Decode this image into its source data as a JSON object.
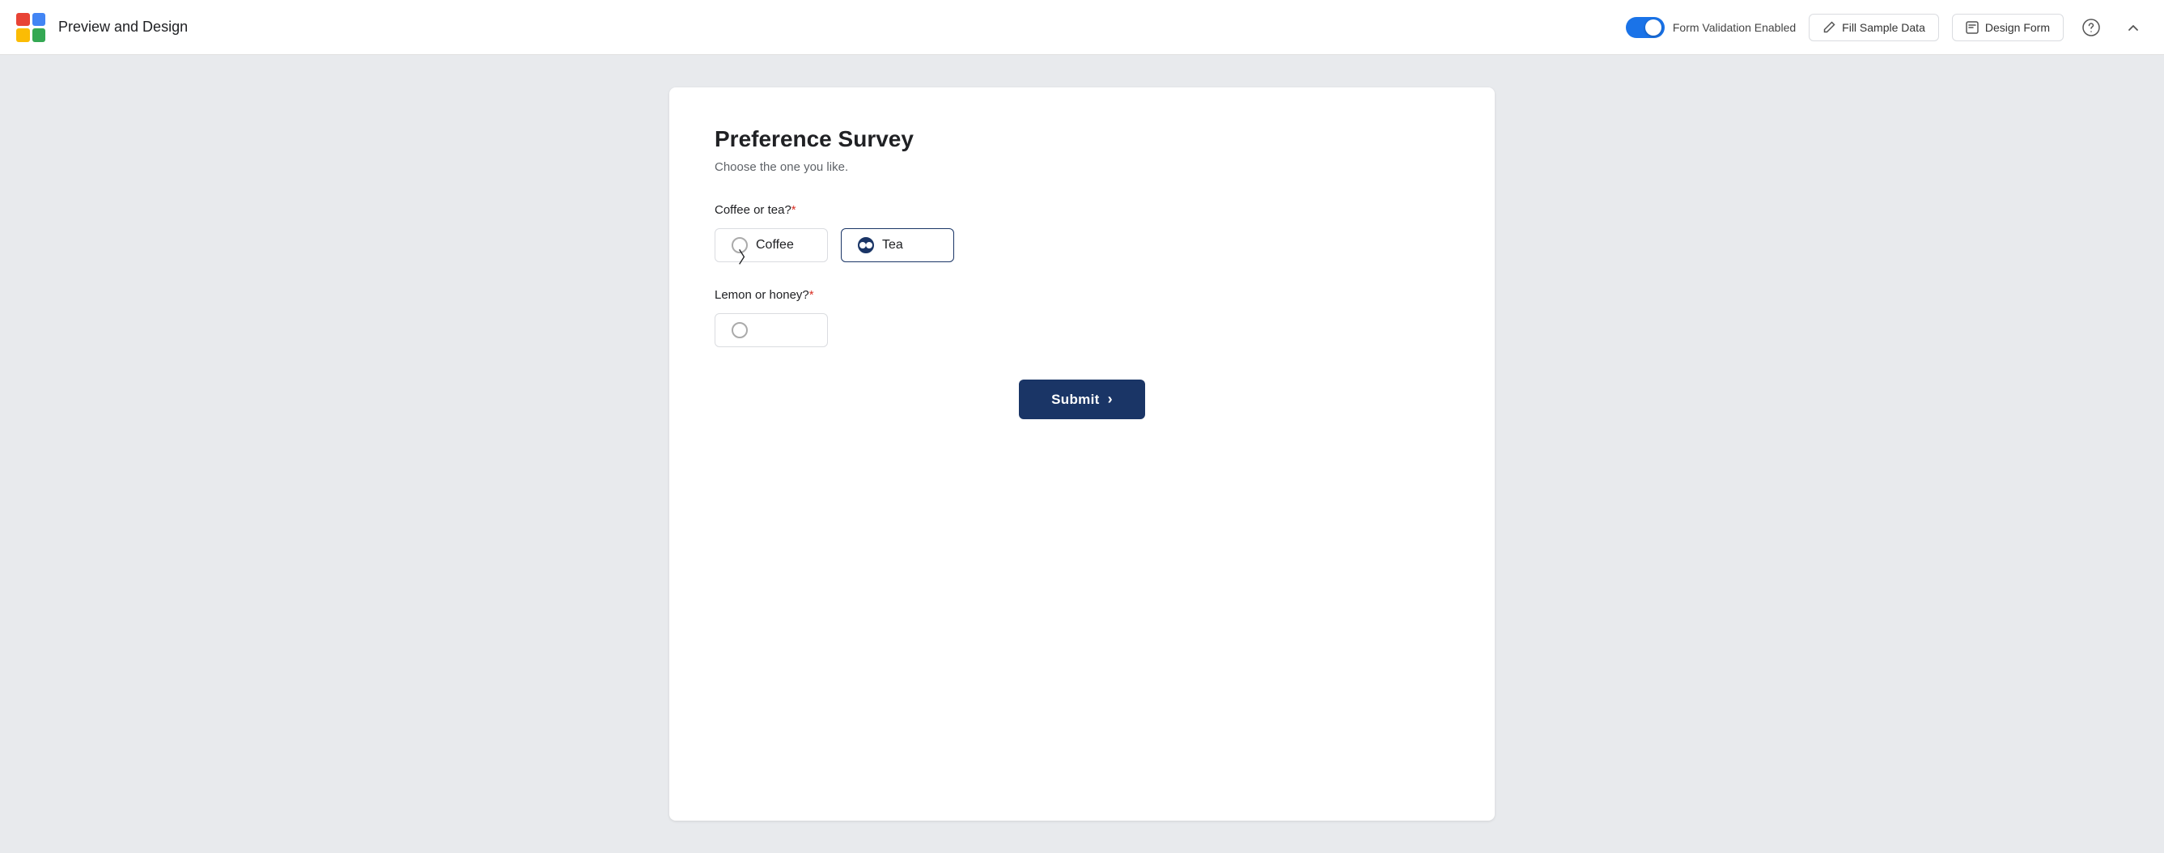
{
  "header": {
    "title": "Preview and Design",
    "toggle_label": "Form Validation Enabled",
    "toggle_enabled": true,
    "fill_sample_data_label": "Fill Sample Data",
    "design_form_label": "Design Form"
  },
  "form": {
    "title": "Preference Survey",
    "subtitle": "Choose the one you like.",
    "questions": [
      {
        "id": "q1",
        "label": "Coffee or tea?",
        "required": true,
        "options": [
          {
            "id": "coffee",
            "label": "Coffee",
            "selected": false
          },
          {
            "id": "tea",
            "label": "Tea",
            "selected": true
          }
        ]
      },
      {
        "id": "q2",
        "label": "Lemon or honey?",
        "required": true,
        "options": []
      }
    ],
    "submit_label": "Submit"
  },
  "colors": {
    "accent": "#1a3566",
    "toggle_on": "#1a73e8"
  }
}
